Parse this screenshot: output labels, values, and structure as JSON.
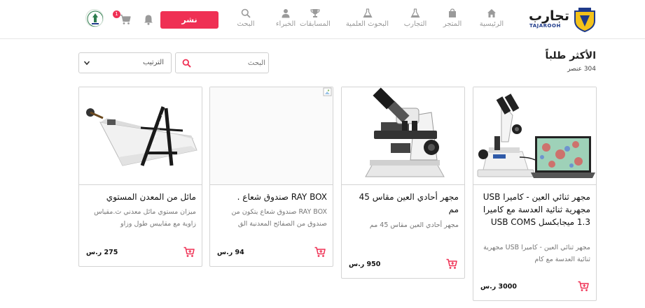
{
  "header": {
    "brand": "تجارب",
    "brand_sub": "TAJAROOH",
    "nav": [
      {
        "label": "الرئيسية",
        "icon": "home-icon"
      },
      {
        "label": "المتجر",
        "icon": "shopping-bag-icon"
      },
      {
        "label": "التجارب",
        "icon": "flask-icon"
      },
      {
        "label": "البحوث العلمية",
        "icon": "flask-icon"
      },
      {
        "label": "المسابقات",
        "icon": "trophy-icon"
      },
      {
        "label": "الخبراء",
        "icon": "user-icon"
      },
      {
        "label": "البحث",
        "icon": "search-icon"
      }
    ],
    "publish_label": "نشر",
    "cart_count": "1"
  },
  "page": {
    "title": "الأكثر طلباً",
    "count": "304 عنصر"
  },
  "search": {
    "placeholder": "البحث"
  },
  "sort": {
    "label": "الترتيب"
  },
  "products": [
    {
      "title": "مجهر ثنائي العين - كاميرا USB مجهرية ثنائية العدسة مع كاميرا 1.3 ميجابكسل USB COMS",
      "desc": "مجهر ثنائي العين - كاميرا USB مجهرية ثنائية العدسة مع كام",
      "price": "3000 ر.س"
    },
    {
      "title": "مجهر أحادي العين مقاس 45 مم",
      "desc": "مجهر أحادي العين مقاس 45 مم",
      "price": "950 ر.س"
    },
    {
      "title": "RAY BOX صندوق شعاع .",
      "desc": "RAY BOX صندوق شعاع يتكون من صندوق من الصفائح المعدنية الق",
      "price": "94 ر.س"
    },
    {
      "title": "مائل من المعدن المستوي",
      "desc": "ميزان مستوي مائل معدني ث.مقياس زاوية مع مقاييس طول وزاو",
      "price": "275 ر.س"
    }
  ],
  "colors": {
    "accent": "#ef3054",
    "border": "#d4d4d4",
    "muted": "#9a9a9a"
  }
}
